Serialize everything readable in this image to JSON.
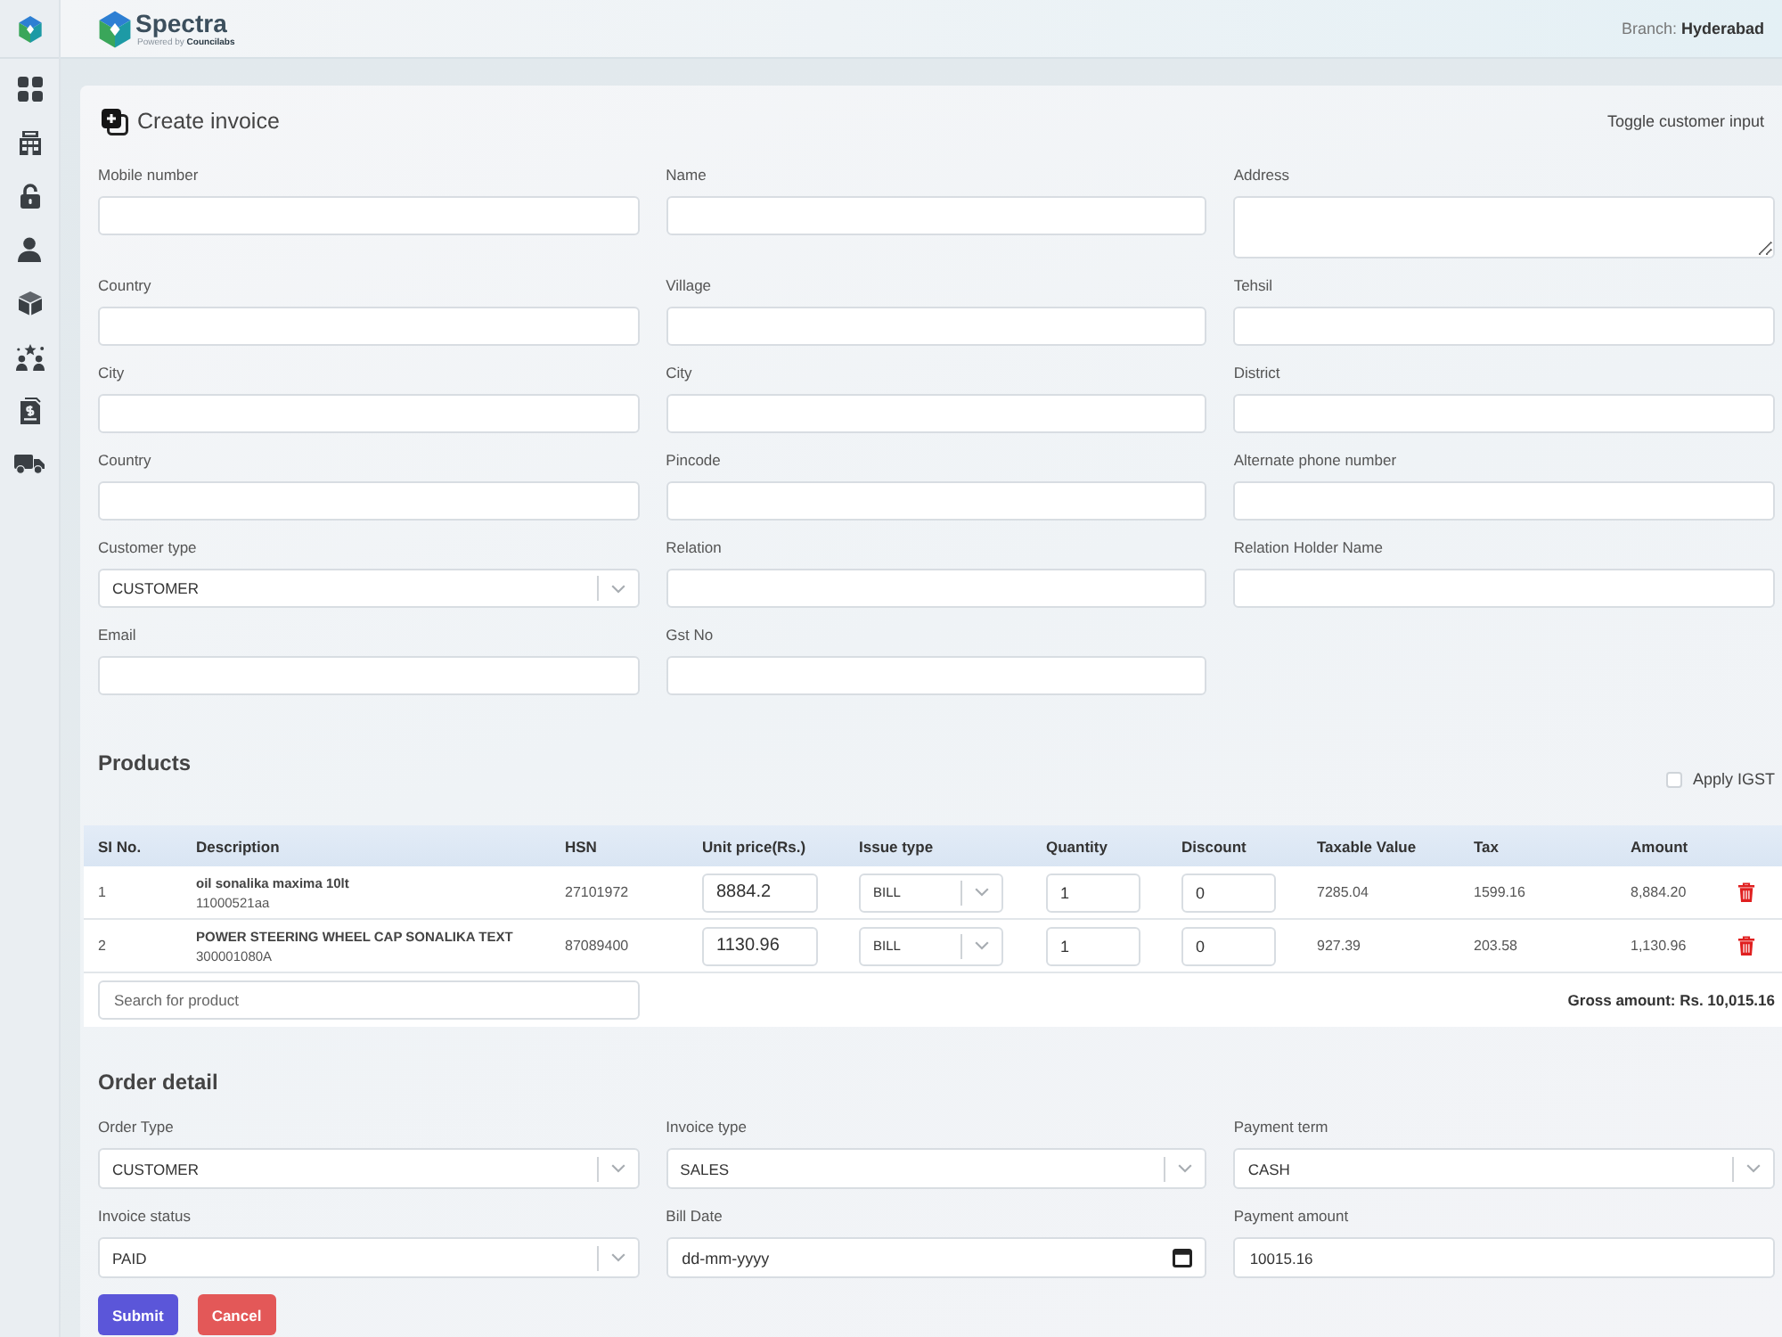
{
  "header": {
    "brand": {
      "name": "Spectra",
      "tagline": "Powered by **Councilabs**"
    },
    "branch": "Branch: **Hyderabad**"
  },
  "invoice": {
    "title": "Create invoice",
    "toggle": "Toggle customer input",
    "customer_fields": [
      {
        "label": "Mobile number",
        "kind": "text"
      },
      {
        "label": "Name",
        "kind": "text"
      },
      {
        "label": "Address",
        "kind": "textarea"
      },
      {
        "label": "Country",
        "kind": "text"
      },
      {
        "label": "Village",
        "kind": "text"
      },
      {
        "label": "Tehsil",
        "kind": "text"
      },
      {
        "label": "City",
        "kind": "text"
      },
      {
        "label": "City",
        "kind": "text"
      },
      {
        "label": "District",
        "kind": "text"
      },
      {
        "label": "Country",
        "kind": "text"
      },
      {
        "label": "Pincode",
        "kind": "text"
      },
      {
        "label": "Alternate phone number",
        "kind": "text"
      },
      {
        "label": "Customer type",
        "kind": "select",
        "value": "CUSTOMER"
      },
      {
        "label": "Relation",
        "kind": "text"
      },
      {
        "label": "Relation Holder Name",
        "kind": "text"
      },
      {
        "label": "Email",
        "kind": "text"
      },
      {
        "label": "Gst No",
        "kind": "text"
      }
    ]
  },
  "products": {
    "title": "Products",
    "apply_igst": {
      "label": "Apply IGST",
      "checked": false
    },
    "table": {
      "columns": [
        "SI No.",
        "Description",
        "HSN",
        "Unit price(Rs.)",
        "Issue type",
        "Quantity",
        "Discount",
        "Taxable Value",
        "Tax",
        "Amount"
      ],
      "rows": [
        {
          "sl_no": "1",
          "name": "oil sonalika maxima 10lt",
          "code": "11000521aa",
          "hsn": "27101972",
          "unit_price": "8884.2",
          "issue_type": "BILL",
          "quantity": "1",
          "discount": "0",
          "taxable_value": "7285.04",
          "tax": "1599.16",
          "amount": "8,884.20"
        },
        {
          "sl_no": "2",
          "name": "POWER STEERING WHEEL CAP SONALIKA TEXT",
          "code": "300001080A",
          "hsn": "87089400",
          "unit_price": "1130.96",
          "issue_type": "BILL",
          "quantity": "1",
          "discount": "0",
          "taxable_value": "927.39",
          "tax": "203.58",
          "amount": "1,130.96"
        }
      ]
    },
    "search": {
      "placeholder": "Search for product"
    },
    "gross_amount": "Gross amount: Rs. 10,015.16"
  },
  "order_detail": {
    "title": "Order detail",
    "fields": [
      {
        "label": "Order Type",
        "kind": "select",
        "value": "CUSTOMER"
      },
      {
        "label": "Invoice type",
        "kind": "select",
        "value": "SALES"
      },
      {
        "label": "Payment term",
        "kind": "select",
        "value": "CASH"
      },
      {
        "label": "Invoice status",
        "kind": "select",
        "value": "PAID"
      },
      {
        "label": "Bill Date",
        "kind": "date",
        "placeholder": "dd-mm-yyyy"
      },
      {
        "label": "Payment amount",
        "kind": "text",
        "value": "10015.16"
      }
    ]
  },
  "actions": [
    {
      "label": "Submit",
      "kind": "primary"
    },
    {
      "label": "Cancel",
      "kind": "danger"
    }
  ]
}
